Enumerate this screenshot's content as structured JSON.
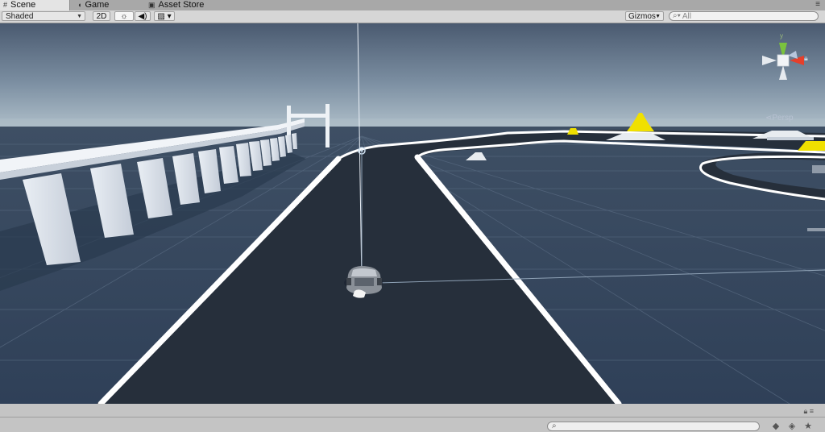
{
  "tabs": [
    {
      "label": "Scene",
      "icon": "grid-icon",
      "active": true
    },
    {
      "label": "Game",
      "icon": "pacman-icon",
      "active": false
    },
    {
      "label": "Asset Store",
      "icon": "store-icon",
      "active": false
    }
  ],
  "toolbar": {
    "draw_mode": "Shaded",
    "btn_2d": "2D",
    "gizmos": "Gizmos",
    "search_placeholder": "All"
  },
  "gizmo": {
    "projection": "Persp"
  },
  "colors": {
    "sky_top": "#4a5a70",
    "horizon": "#b2c2cc",
    "ground": "#34465e",
    "track": "#262f3b",
    "lines": "#ffffff",
    "marker": "#f0e000",
    "axis_x": "#e53f2b",
    "axis_y": "#7ac23d"
  }
}
